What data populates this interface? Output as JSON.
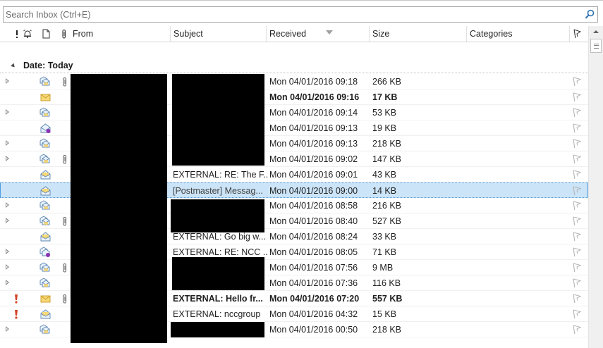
{
  "search": {
    "placeholder": "Search Inbox (Ctrl+E)"
  },
  "columns": {
    "from": "From",
    "subject": "Subject",
    "received": "Received",
    "size": "Size",
    "categories": "Categories"
  },
  "group": {
    "label": "Date: Today"
  },
  "rows": [
    {
      "expander": true,
      "importance": false,
      "icon": "conversation",
      "attachment": true,
      "subject": "",
      "received": "Mon 04/01/2016 09:18",
      "size": "266 KB",
      "bold": false,
      "selected": false
    },
    {
      "expander": false,
      "importance": false,
      "icon": "unread",
      "attachment": false,
      "subject": "",
      "received": "Mon 04/01/2016 09:16",
      "size": "17 KB",
      "bold": true,
      "selected": false
    },
    {
      "expander": true,
      "importance": false,
      "icon": "conversation",
      "attachment": false,
      "subject": "",
      "received": "Mon 04/01/2016 09:14",
      "size": "53 KB",
      "bold": false,
      "selected": false
    },
    {
      "expander": false,
      "importance": false,
      "icon": "meeting",
      "attachment": false,
      "subject": "",
      "received": "Mon 04/01/2016 09:13",
      "size": "19 KB",
      "bold": false,
      "selected": false
    },
    {
      "expander": true,
      "importance": false,
      "icon": "conversation",
      "attachment": false,
      "subject": "",
      "received": "Mon 04/01/2016 09:13",
      "size": "218 KB",
      "bold": false,
      "selected": false
    },
    {
      "expander": true,
      "importance": false,
      "icon": "conversation",
      "attachment": true,
      "subject": "",
      "received": "Mon 04/01/2016 09:02",
      "size": "147 KB",
      "bold": false,
      "selected": false
    },
    {
      "expander": false,
      "importance": false,
      "icon": "read",
      "attachment": false,
      "subject": "EXTERNAL: RE: The F...",
      "received": "Mon 04/01/2016 09:01",
      "size": "43 KB",
      "bold": false,
      "selected": false
    },
    {
      "expander": false,
      "importance": false,
      "icon": "read",
      "attachment": false,
      "subject": "[Postmaster] Messag...",
      "received": "Mon 04/01/2016 09:00",
      "size": "14 KB",
      "bold": false,
      "selected": true
    },
    {
      "expander": true,
      "importance": false,
      "icon": "conversation",
      "attachment": false,
      "subject": "",
      "received": "Mon 04/01/2016 08:58",
      "size": "216 KB",
      "bold": false,
      "selected": false
    },
    {
      "expander": true,
      "importance": false,
      "icon": "conversation",
      "attachment": true,
      "subject": "",
      "received": "Mon 04/01/2016 08:40",
      "size": "527 KB",
      "bold": false,
      "selected": false
    },
    {
      "expander": false,
      "importance": false,
      "icon": "read",
      "attachment": false,
      "subject": "EXTERNAL: Go big w...",
      "received": "Mon 04/01/2016 08:24",
      "size": "33 KB",
      "bold": false,
      "selected": false
    },
    {
      "expander": true,
      "importance": false,
      "icon": "conversation-meeting",
      "attachment": false,
      "subject": "EXTERNAL: RE: NCC ...",
      "received": "Mon 04/01/2016 08:05",
      "size": "71 KB",
      "bold": false,
      "selected": false
    },
    {
      "expander": true,
      "importance": false,
      "icon": "conversation",
      "attachment": true,
      "subject": "",
      "received": "Mon 04/01/2016 07:56",
      "size": "9 MB",
      "bold": false,
      "selected": false
    },
    {
      "expander": true,
      "importance": false,
      "icon": "conversation",
      "attachment": false,
      "subject": "",
      "received": "Mon 04/01/2016 07:36",
      "size": "116 KB",
      "bold": false,
      "selected": false
    },
    {
      "expander": false,
      "importance": true,
      "icon": "unread",
      "attachment": true,
      "subject": "EXTERNAL: Hello fr...",
      "received": "Mon 04/01/2016 07:20",
      "size": "557 KB",
      "bold": true,
      "selected": false
    },
    {
      "expander": false,
      "importance": true,
      "icon": "read",
      "attachment": false,
      "subject": "EXTERNAL: nccgroup",
      "received": "Mon 04/01/2016 04:32",
      "size": "15 KB",
      "bold": false,
      "selected": false
    },
    {
      "expander": true,
      "importance": false,
      "icon": "conversation",
      "attachment": false,
      "subject": "",
      "received": "Mon 04/01/2016 00:50",
      "size": "218 KB",
      "bold": false,
      "selected": false
    }
  ]
}
